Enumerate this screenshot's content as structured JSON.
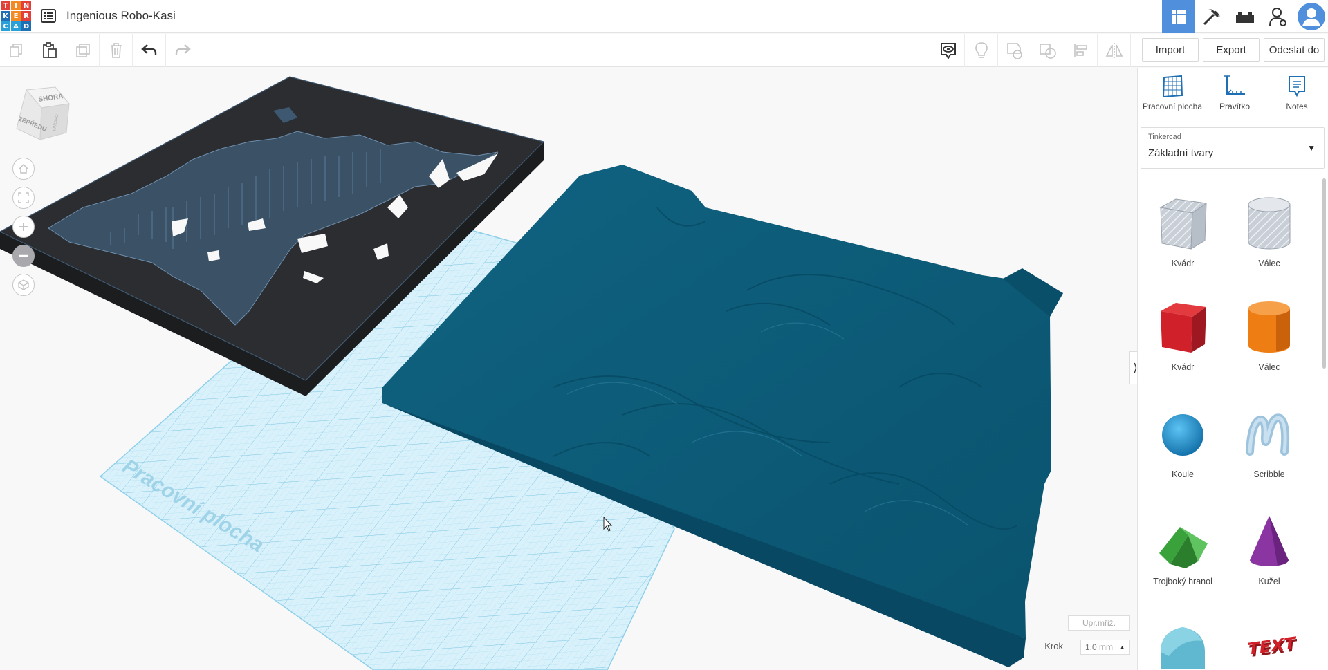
{
  "app": {
    "logo_letters": [
      "T",
      "I",
      "N",
      "K",
      "E",
      "R",
      "C",
      "A",
      "D"
    ],
    "project_title": "Ingenious Robo-Kasi"
  },
  "topbar": {
    "icons": [
      "grid-view-icon",
      "pickaxe-icon",
      "bricks-icon",
      "add-user-icon",
      "user-avatar-icon"
    ],
    "accent": "#4f8fdb"
  },
  "toolbar": {
    "import_label": "Import",
    "export_label": "Export",
    "send_label": "Odeslat do"
  },
  "viewcube": {
    "top_label": "SHORA",
    "front_label": "ZEPŘEDU",
    "side_label": "VPRAVO"
  },
  "workplane": {
    "watermark": "Pracovní plocha",
    "grid_edit_label": "Upr.mřiž.",
    "step_label": "Krok",
    "step_value": "1,0 mm"
  },
  "panel": {
    "tools": [
      {
        "label": "Pracovní plocha",
        "icon": "workplane-icon"
      },
      {
        "label": "Pravítko",
        "icon": "ruler-icon"
      },
      {
        "label": "Notes",
        "icon": "notes-icon"
      }
    ],
    "library": {
      "provider": "Tinkercad",
      "category": "Základní tvary"
    },
    "shapes": [
      {
        "label": "Kvádr",
        "icon": "box-hole-icon"
      },
      {
        "label": "Válec",
        "icon": "cylinder-hole-icon"
      },
      {
        "label": "Kvádr",
        "icon": "box-icon"
      },
      {
        "label": "Válec",
        "icon": "cylinder-icon"
      },
      {
        "label": "Koule",
        "icon": "sphere-icon"
      },
      {
        "label": "Scribble",
        "icon": "scribble-icon"
      },
      {
        "label": "Trojboký hranol",
        "icon": "prism-icon"
      },
      {
        "label": "Kužel",
        "icon": "cone-icon"
      },
      {
        "label": "",
        "icon": "half-cylinder-icon"
      },
      {
        "label": "",
        "icon": "text-icon"
      }
    ]
  },
  "colors": {
    "terrain": "#0c5a77",
    "frame": "#27292c",
    "grid": "#b9e3f3",
    "box": "#d0202a",
    "cylinder": "#ee7d14",
    "sphere": "#1c8fd1",
    "prism": "#3aa23a",
    "cone": "#8b35a3"
  }
}
